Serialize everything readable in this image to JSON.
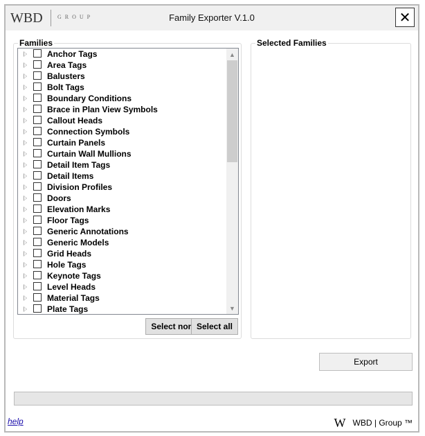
{
  "window": {
    "logo_text": "WBD",
    "logo_sub": "GROUP",
    "title": "Family Exporter V.1.0",
    "close_glyph": "✕"
  },
  "families": {
    "legend": "Families",
    "items": [
      {
        "label": "Anchor Tags"
      },
      {
        "label": "Area Tags"
      },
      {
        "label": "Balusters"
      },
      {
        "label": "Bolt Tags"
      },
      {
        "label": "Boundary Conditions"
      },
      {
        "label": "Brace in Plan View Symbols"
      },
      {
        "label": "Callout Heads"
      },
      {
        "label": "Connection Symbols"
      },
      {
        "label": "Curtain Panels"
      },
      {
        "label": "Curtain Wall Mullions"
      },
      {
        "label": "Detail Item Tags"
      },
      {
        "label": "Detail Items"
      },
      {
        "label": "Division Profiles"
      },
      {
        "label": "Doors"
      },
      {
        "label": "Elevation Marks"
      },
      {
        "label": "Floor Tags"
      },
      {
        "label": "Generic Annotations"
      },
      {
        "label": "Generic Models"
      },
      {
        "label": "Grid Heads"
      },
      {
        "label": "Hole Tags"
      },
      {
        "label": "Keynote Tags"
      },
      {
        "label": "Level Heads"
      },
      {
        "label": "Material Tags"
      },
      {
        "label": "Plate Tags"
      }
    ],
    "select_none_label": "Select none",
    "select_all_label": "Select all"
  },
  "selected": {
    "legend": "Selected Families"
  },
  "export_label": "Export",
  "progress": 0,
  "footer": {
    "help_label": "help",
    "logo_glyph": "W",
    "brand_text": "WBD | Group ™"
  }
}
